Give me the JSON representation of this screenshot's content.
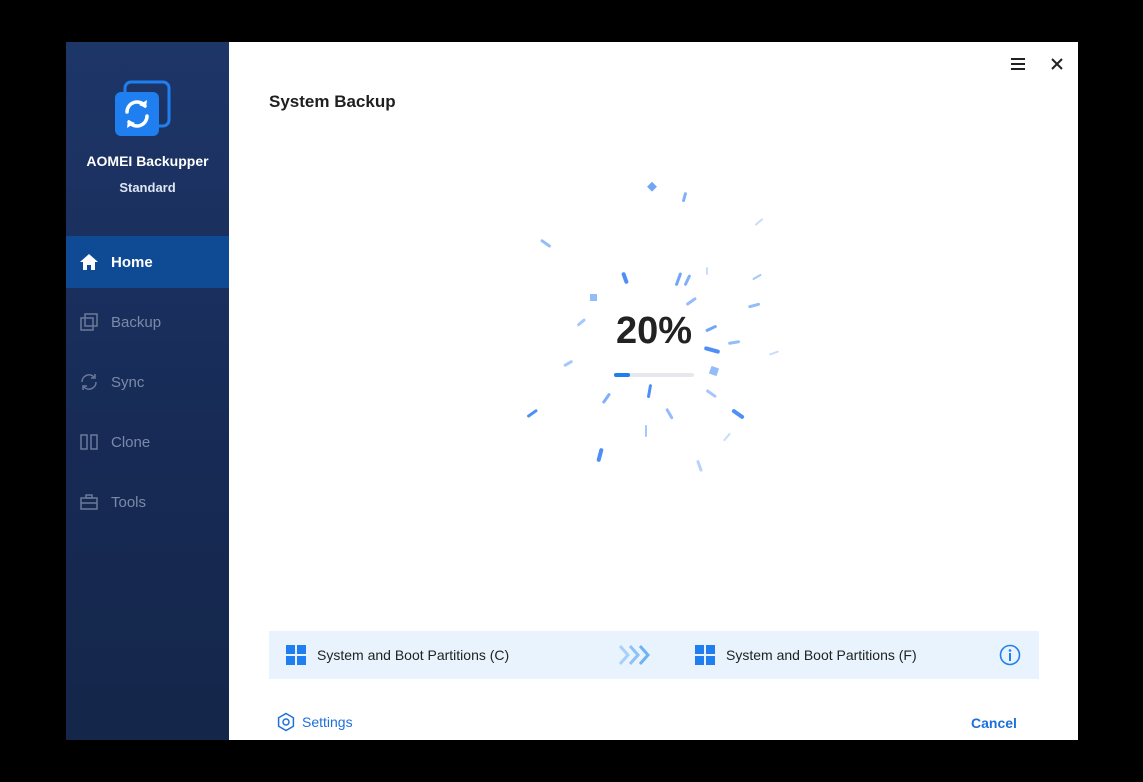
{
  "app": {
    "name": "AOMEI Backupper",
    "edition": "Standard",
    "brand_color": "#1f7ff0"
  },
  "sidebar": {
    "items": [
      {
        "label": "Home",
        "icon": "home-icon",
        "active": true
      },
      {
        "label": "Backup",
        "icon": "backup-icon",
        "active": false
      },
      {
        "label": "Sync",
        "icon": "sync-icon",
        "active": false
      },
      {
        "label": "Clone",
        "icon": "clone-icon",
        "active": false
      },
      {
        "label": "Tools",
        "icon": "tools-icon",
        "active": false
      }
    ]
  },
  "window_controls": {
    "menu_icon": "hamburger-menu-icon",
    "close_icon": "close-icon"
  },
  "main": {
    "title": "System Backup",
    "progress": {
      "percent_text": "20%",
      "fraction": 0.2
    },
    "source": {
      "label": "System and Boot Partitions (C)",
      "icon": "windows-icon"
    },
    "destination": {
      "label": "System and Boot Partitions (F)",
      "icon": "windows-icon"
    },
    "info_icon": "info-icon"
  },
  "footer": {
    "settings_label": "Settings",
    "cancel_label": "Cancel"
  }
}
